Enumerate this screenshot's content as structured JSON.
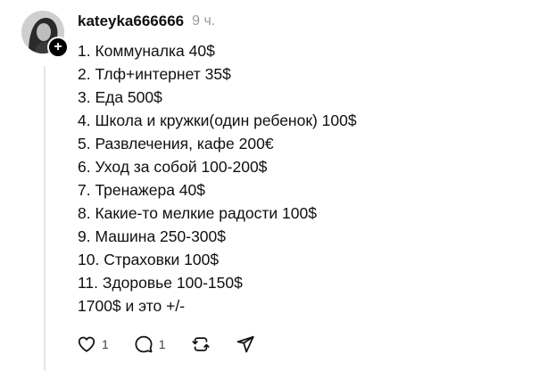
{
  "post": {
    "username": "kateyka666666",
    "timestamp": "9 ч.",
    "lines": [
      "1. Коммуналка 40$",
      "2. Тлф+интернет 35$",
      "3. Еда 500$",
      "4. Школа и кружки(один ребенок) 100$",
      "5. Развлечения, кафе 200€",
      "6. Уход за собой 100-200$",
      "7. Тренажера 40$",
      "8. Какие-то мелкие радости 100$",
      "9. Машина 250-300$",
      "10. Страховки 100$",
      "11. Здоровье 100-150$",
      "1700$ и это +/-"
    ]
  },
  "avatar": {
    "badge": "+"
  },
  "actions": {
    "like_icon": "heart-icon",
    "like_count": "1",
    "comment_icon": "comment-icon",
    "comment_count": "1",
    "repost_icon": "repost-icon",
    "share_icon": "send-icon"
  }
}
